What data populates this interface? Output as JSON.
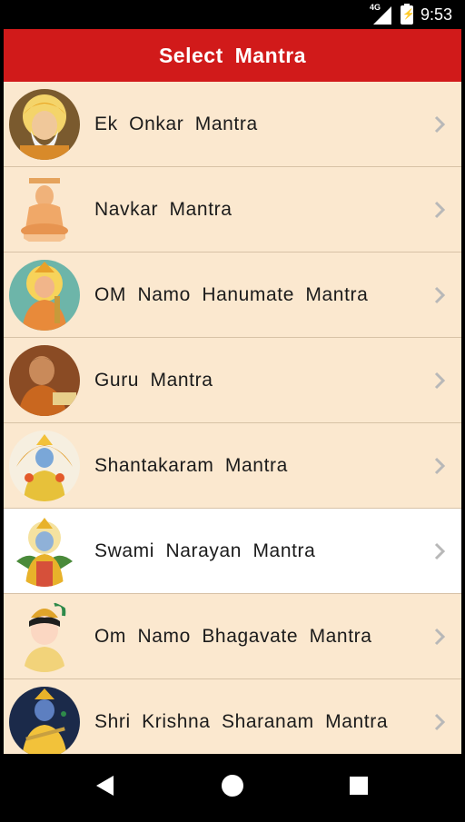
{
  "status_bar": {
    "network": "4G",
    "time": "9:53"
  },
  "header": {
    "title": "Select  Mantra"
  },
  "mantras": [
    {
      "label": "Ek  Onkar  Mantra",
      "icon": "guru-nanak-portrait-icon"
    },
    {
      "label": "Navkar  Mantra",
      "icon": "jain-tirthankara-idol-icon"
    },
    {
      "label": "OM  Namo  Hanumate  Mantra",
      "icon": "hanuman-portrait-icon"
    },
    {
      "label": "Guru  Mantra",
      "icon": "guru-portrait-icon"
    },
    {
      "label": "Shantakaram  Mantra",
      "icon": "vishnu-portrait-icon"
    },
    {
      "label": "Swami  Narayan  Mantra",
      "icon": "narayan-portrait-icon"
    },
    {
      "label": "Om  Namo  Bhagavate  Mantra",
      "icon": "krishna-child-portrait-icon"
    },
    {
      "label": "Shri  Krishna  Sharanam  Mantra",
      "icon": "krishna-flute-portrait-icon"
    }
  ],
  "selected_index": 5,
  "colors": {
    "header_red": "#d11a1a",
    "list_bg": "#fbe8cf",
    "selected_bg": "#ffffff",
    "divider": "#d7c2a6"
  }
}
